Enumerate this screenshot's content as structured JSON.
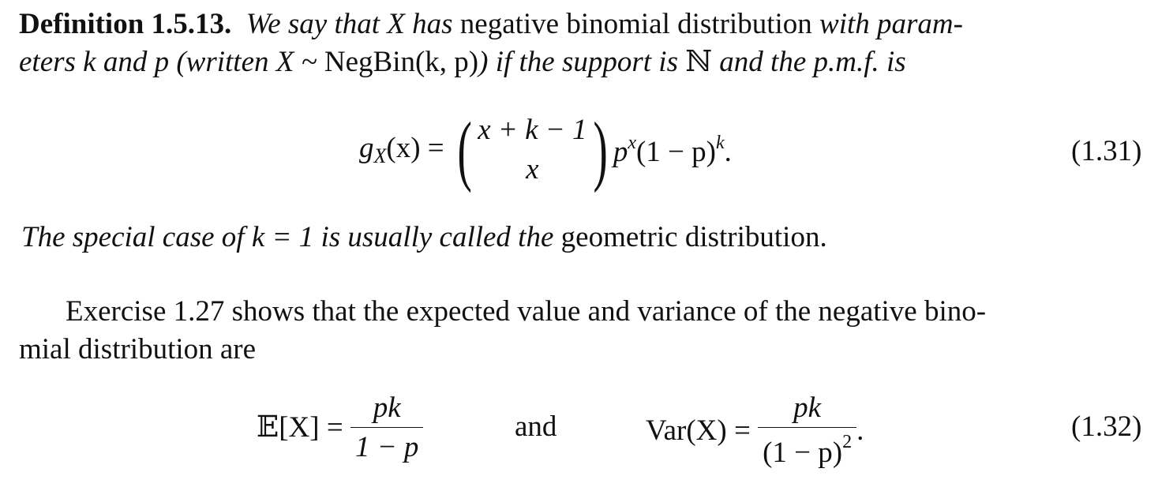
{
  "definition": {
    "label": "Definition 1.5.13.",
    "line1": {
      "italic_a": "We say that X has",
      "roman": "negative binomial distribution",
      "italic_b": "with param-"
    },
    "line2": {
      "italic_a": "eters k and p (written X ~",
      "roman": "NegBin(k, p)",
      "italic_b": ") if the support is",
      "set_symbol": "ℕ",
      "italic_c": "and the p.m.f. is"
    }
  },
  "equation_131": {
    "lhs": "g",
    "lhs_sub": "X",
    "lhs_arg": "(x) =",
    "binom_top": "x + k − 1",
    "binom_bottom": "x",
    "rhs_p": "p",
    "rhs_p_exp": "x",
    "rhs_rest": "(1 − p)",
    "rhs_exp": "k",
    "end": ".",
    "number": "(1.31)"
  },
  "special_case": {
    "italic": "The special case of k = 1 is usually called the",
    "roman": "geometric distribution."
  },
  "paragraph": {
    "line1": "Exercise 1.27 shows that the expected value and variance of the negative bino-",
    "line2": "mial distribution are"
  },
  "equation_132": {
    "expectation_lhs": "𝔼[X] =",
    "expectation_num": "pk",
    "expectation_den": "1 − p",
    "connector": "and",
    "variance_lhs": "Var(X) =",
    "variance_num": "pk",
    "variance_den": "(1 − p)",
    "variance_den_exp": "2",
    "end": ".",
    "number": "(1.32)"
  }
}
